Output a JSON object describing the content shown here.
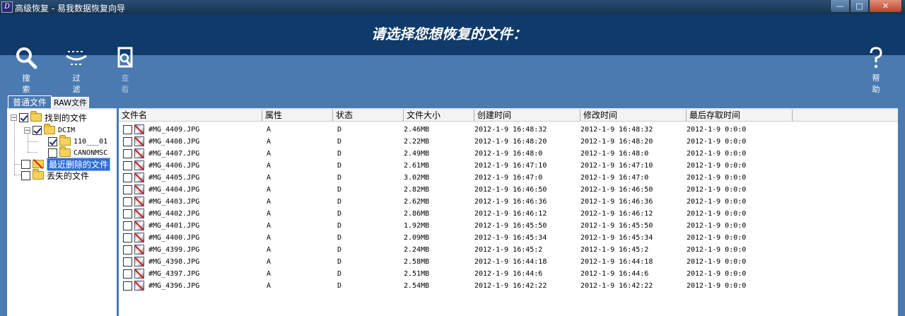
{
  "window": {
    "title": "高级恢复 - 易我数据恢复向导",
    "app_icon": "D"
  },
  "header": {
    "heading": "请选择您想恢复的文件："
  },
  "toolbar": {
    "search": "搜 索",
    "filter": "过 滤",
    "view": "查 看",
    "help": "帮 助"
  },
  "tabs": {
    "normal": "普通文件",
    "raw": "RAW文件"
  },
  "tree": {
    "found": "找到的文件",
    "dcim": "DCIM",
    "sub1": "110___01",
    "sub2": "CANONMSC",
    "recent_deleted": "最近删除的文件",
    "lost": "丢失的文件"
  },
  "columns": [
    "文件名",
    "属性",
    "状态",
    "文件大小",
    "创建时间",
    "修改时间",
    "最后存取时间"
  ],
  "files": [
    {
      "name": "#MG_4409.JPG",
      "attr": "A",
      "status": "D",
      "size": "2.46MB",
      "created": "2012-1-9 16:48:32",
      "modified": "2012-1-9 16:48:32",
      "accessed": "2012-1-9 0:0:0"
    },
    {
      "name": "#MG_4408.JPG",
      "attr": "A",
      "status": "D",
      "size": "2.22MB",
      "created": "2012-1-9 16:48:20",
      "modified": "2012-1-9 16:48:20",
      "accessed": "2012-1-9 0:0:0"
    },
    {
      "name": "#MG_4407.JPG",
      "attr": "A",
      "status": "D",
      "size": "2.49MB",
      "created": "2012-1-9 16:48:0",
      "modified": "2012-1-9 16:48:0",
      "accessed": "2012-1-9 0:0:0"
    },
    {
      "name": "#MG_4406.JPG",
      "attr": "A",
      "status": "D",
      "size": "2.61MB",
      "created": "2012-1-9 16:47:10",
      "modified": "2012-1-9 16:47:10",
      "accessed": "2012-1-9 0:0:0"
    },
    {
      "name": "#MG_4405.JPG",
      "attr": "A",
      "status": "D",
      "size": "3.02MB",
      "created": "2012-1-9 16:47:0",
      "modified": "2012-1-9 16:47:0",
      "accessed": "2012-1-9 0:0:0"
    },
    {
      "name": "#MG_4404.JPG",
      "attr": "A",
      "status": "D",
      "size": "2.82MB",
      "created": "2012-1-9 16:46:50",
      "modified": "2012-1-9 16:46:50",
      "accessed": "2012-1-9 0:0:0"
    },
    {
      "name": "#MG_4403.JPG",
      "attr": "A",
      "status": "D",
      "size": "2.62MB",
      "created": "2012-1-9 16:46:36",
      "modified": "2012-1-9 16:46:36",
      "accessed": "2012-1-9 0:0:0"
    },
    {
      "name": "#MG_4402.JPG",
      "attr": "A",
      "status": "D",
      "size": "2.86MB",
      "created": "2012-1-9 16:46:12",
      "modified": "2012-1-9 16:46:12",
      "accessed": "2012-1-9 0:0:0"
    },
    {
      "name": "#MG_4401.JPG",
      "attr": "A",
      "status": "D",
      "size": "1.92MB",
      "created": "2012-1-9 16:45:50",
      "modified": "2012-1-9 16:45:50",
      "accessed": "2012-1-9 0:0:0"
    },
    {
      "name": "#MG_4400.JPG",
      "attr": "A",
      "status": "D",
      "size": "2.09MB",
      "created": "2012-1-9 16:45:34",
      "modified": "2012-1-9 16:45:34",
      "accessed": "2012-1-9 0:0:0"
    },
    {
      "name": "#MG_4399.JPG",
      "attr": "A",
      "status": "D",
      "size": "2.24MB",
      "created": "2012-1-9 16:45:2",
      "modified": "2012-1-9 16:45:2",
      "accessed": "2012-1-9 0:0:0"
    },
    {
      "name": "#MG_4398.JPG",
      "attr": "A",
      "status": "D",
      "size": "2.58MB",
      "created": "2012-1-9 16:44:18",
      "modified": "2012-1-9 16:44:18",
      "accessed": "2012-1-9 0:0:0"
    },
    {
      "name": "#MG_4397.JPG",
      "attr": "A",
      "status": "D",
      "size": "2.51MB",
      "created": "2012-1-9 16:44:6",
      "modified": "2012-1-9 16:44:6",
      "accessed": "2012-1-9 0:0:0"
    },
    {
      "name": "#MG_4396.JPG",
      "attr": "A",
      "status": "D",
      "size": "2.54MB",
      "created": "2012-1-9 16:42:22",
      "modified": "2012-1-9 16:42:22",
      "accessed": "2012-1-9 0:0:0"
    }
  ]
}
